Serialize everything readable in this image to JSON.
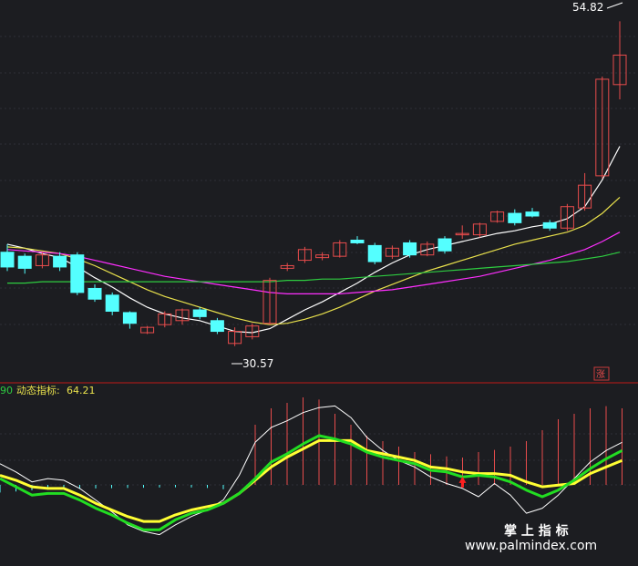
{
  "chart_data": [
    {
      "type": "candlestick",
      "price_range": [
        28.0,
        56.0
      ],
      "high_label": "54.82",
      "low_label": "30.57",
      "rise_marker": "涨",
      "candles": [
        {
          "o": 37.6,
          "c": 36.5,
          "h": 38.2,
          "l": 36.2
        },
        {
          "o": 37.3,
          "c": 36.4,
          "h": 37.5,
          "l": 36.0
        },
        {
          "o": 36.6,
          "c": 37.4,
          "h": 37.6,
          "l": 36.4
        },
        {
          "o": 37.3,
          "c": 36.5,
          "h": 37.6,
          "l": 36.2
        },
        {
          "o": 37.4,
          "c": 34.6,
          "h": 37.6,
          "l": 34.4
        },
        {
          "o": 34.9,
          "c": 34.1,
          "h": 35.2,
          "l": 33.9
        },
        {
          "o": 34.4,
          "c": 33.2,
          "h": 34.6,
          "l": 32.9
        },
        {
          "o": 33.1,
          "c": 32.3,
          "h": 33.2,
          "l": 31.9
        },
        {
          "o": 31.6,
          "c": 32.0,
          "h": 32.1,
          "l": 31.5
        },
        {
          "o": 32.2,
          "c": 33.0,
          "h": 33.2,
          "l": 32.0
        },
        {
          "o": 32.5,
          "c": 33.3,
          "h": 33.4,
          "l": 32.2
        },
        {
          "o": 33.3,
          "c": 32.8,
          "h": 33.5,
          "l": 32.6
        },
        {
          "o": 32.5,
          "c": 31.7,
          "h": 32.7,
          "l": 31.5
        },
        {
          "o": 30.8,
          "c": 31.7,
          "h": 32.0,
          "l": 30.6
        },
        {
          "o": 31.3,
          "c": 32.1,
          "h": 32.3,
          "l": 31.1
        },
        {
          "o": 32.3,
          "c": 35.5,
          "h": 35.7,
          "l": 32.2
        },
        {
          "o": 36.4,
          "c": 36.6,
          "h": 36.8,
          "l": 36.2
        },
        {
          "o": 37.0,
          "c": 37.8,
          "h": 38.0,
          "l": 36.8
        },
        {
          "o": 37.2,
          "c": 37.4,
          "h": 37.6,
          "l": 37.0
        },
        {
          "o": 37.3,
          "c": 38.3,
          "h": 38.5,
          "l": 37.2
        },
        {
          "o": 38.5,
          "c": 38.3,
          "h": 38.8,
          "l": 38.2
        },
        {
          "o": 38.1,
          "c": 36.9,
          "h": 38.3,
          "l": 36.7
        },
        {
          "o": 37.3,
          "c": 37.9,
          "h": 38.1,
          "l": 37.1
        },
        {
          "o": 38.3,
          "c": 37.4,
          "h": 38.5,
          "l": 37.2
        },
        {
          "o": 37.4,
          "c": 38.2,
          "h": 38.4,
          "l": 37.3
        },
        {
          "o": 38.6,
          "c": 37.7,
          "h": 38.8,
          "l": 37.5
        },
        {
          "o": 38.9,
          "c": 39.0,
          "h": 39.6,
          "l": 38.6
        },
        {
          "o": 38.9,
          "c": 39.7,
          "h": 39.8,
          "l": 38.7
        },
        {
          "o": 39.9,
          "c": 40.6,
          "h": 40.7,
          "l": 39.8
        },
        {
          "o": 40.5,
          "c": 39.8,
          "h": 40.8,
          "l": 39.6
        },
        {
          "o": 40.6,
          "c": 40.3,
          "h": 40.9,
          "l": 40.2
        },
        {
          "o": 39.8,
          "c": 39.4,
          "h": 40.0,
          "l": 39.2
        },
        {
          "o": 39.4,
          "c": 41.0,
          "h": 41.2,
          "l": 39.2
        },
        {
          "o": 40.9,
          "c": 42.6,
          "h": 43.5,
          "l": 40.7
        },
        {
          "o": 43.3,
          "c": 50.5,
          "h": 50.7,
          "l": 43.1
        },
        {
          "o": 50.1,
          "c": 52.3,
          "h": 54.82,
          "l": 49.0
        }
      ],
      "ma_series": [
        {
          "color": "#ffffff",
          "values": [
            38.2,
            37.9,
            37.5,
            37.2,
            36.5,
            35.7,
            35.0,
            34.2,
            33.5,
            33.0,
            32.7,
            32.5,
            32.1,
            31.7,
            31.6,
            31.9,
            32.6,
            33.3,
            33.9,
            34.6,
            35.3,
            36.1,
            36.8,
            37.4,
            37.8,
            38.1,
            38.4,
            38.7,
            39.0,
            39.2,
            39.5,
            39.7,
            40.1,
            41.0,
            43.0,
            45.5
          ]
        },
        {
          "color": "#e8e04c",
          "values": [
            38.0,
            37.9,
            37.7,
            37.5,
            37.1,
            36.6,
            36.0,
            35.4,
            34.8,
            34.3,
            33.9,
            33.5,
            33.1,
            32.7,
            32.4,
            32.2,
            32.3,
            32.6,
            33.0,
            33.5,
            34.1,
            34.7,
            35.2,
            35.7,
            36.2,
            36.6,
            37.0,
            37.4,
            37.8,
            38.2,
            38.5,
            38.8,
            39.1,
            39.6,
            40.5,
            41.7
          ]
        },
        {
          "color": "#ff2eff",
          "values": [
            37.8,
            37.7,
            37.6,
            37.5,
            37.3,
            37.0,
            36.7,
            36.4,
            36.1,
            35.8,
            35.6,
            35.4,
            35.2,
            35.0,
            34.8,
            34.6,
            34.5,
            34.5,
            34.5,
            34.5,
            34.6,
            34.7,
            34.8,
            35.0,
            35.2,
            35.4,
            35.6,
            35.8,
            36.1,
            36.4,
            36.7,
            37.0,
            37.4,
            37.8,
            38.4,
            39.1
          ]
        },
        {
          "color": "#2ecc40",
          "values": [
            35.3,
            35.3,
            35.4,
            35.4,
            35.4,
            35.4,
            35.4,
            35.4,
            35.4,
            35.4,
            35.4,
            35.4,
            35.4,
            35.4,
            35.4,
            35.4,
            35.5,
            35.5,
            35.6,
            35.6,
            35.7,
            35.8,
            35.9,
            36.0,
            36.1,
            36.2,
            36.3,
            36.4,
            36.5,
            36.6,
            36.7,
            36.8,
            36.9,
            37.1,
            37.3,
            37.6
          ]
        }
      ]
    },
    {
      "type": "line",
      "left_value_fragment": "90",
      "indicator_name": "动态指标:",
      "indicator_value": "64.21",
      "range": [
        0,
        100
      ],
      "white_line": [
        62,
        57,
        51,
        53,
        52,
        47,
        40,
        33,
        25,
        21,
        19,
        25,
        30,
        34,
        40,
        55,
        75,
        84,
        88,
        93,
        96,
        97,
        90,
        78,
        70,
        64,
        60,
        54,
        50,
        47,
        42,
        50,
        43,
        32,
        35,
        43,
        53,
        63,
        70,
        75
      ],
      "yellow_line": [
        55,
        52,
        48,
        47,
        47,
        43,
        38,
        34,
        30,
        27,
        27,
        31,
        34,
        36,
        38,
        44,
        52,
        60,
        66,
        71,
        76,
        76,
        76,
        70,
        68,
        66,
        64,
        60,
        59,
        57,
        56,
        56,
        55,
        51,
        48,
        49,
        50,
        56,
        60,
        64
      ],
      "green_line": [
        53,
        48,
        43,
        44,
        44,
        40,
        35,
        31,
        26,
        22,
        22,
        28,
        32,
        34,
        38,
        44,
        53,
        63,
        68,
        74,
        79,
        77,
        74,
        69,
        66,
        64,
        62,
        58,
        57,
        54,
        55,
        54,
        51,
        46,
        42,
        46,
        52,
        59,
        65,
        70
      ],
      "histogram_values": [
        35,
        30,
        25,
        22,
        20,
        18,
        16,
        15,
        14,
        13,
        12,
        11,
        12,
        14,
        20,
        0,
        55,
        70,
        75,
        80,
        78,
        65,
        55,
        45,
        40,
        35,
        30,
        28,
        26,
        25,
        30,
        32,
        35,
        40,
        50,
        60,
        65,
        70,
        72,
        70
      ],
      "red_arrow_index": 29,
      "red_arrow_value": 52
    }
  ],
  "watermark": {
    "line1": "掌 上 指 标",
    "line2": "www.palmindex.com"
  }
}
